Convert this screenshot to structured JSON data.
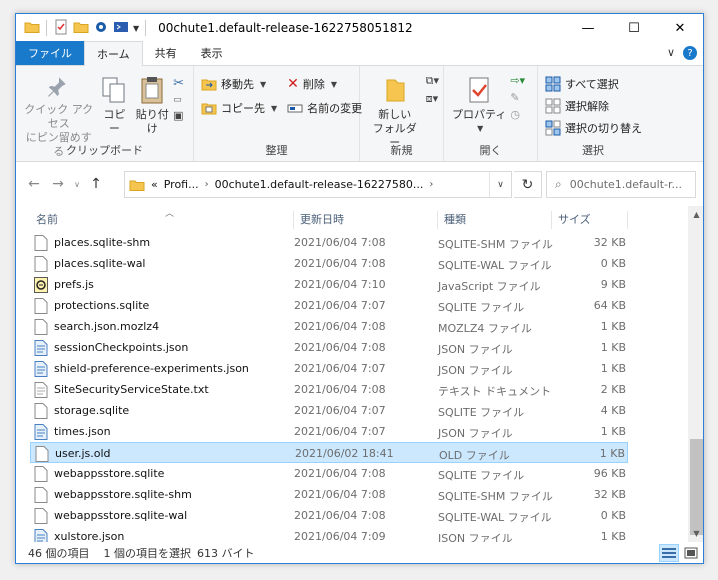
{
  "window": {
    "title": "00chute1.default-release-1622758051812",
    "controls": {
      "minimize": "—",
      "maximize": "☐",
      "close": "✕"
    }
  },
  "ribbon_tabs": {
    "file": "ファイル",
    "home": "ホーム",
    "share": "共有",
    "view": "表示"
  },
  "ribbon": {
    "clipboard": {
      "label": "クリップボード",
      "pin_line1": "クイック アクセス",
      "pin_line2": "にピン留めする",
      "copy": "コピー",
      "paste": "貼り付け"
    },
    "organize": {
      "label": "整理",
      "move_to": "移動先",
      "copy_to": "コピー先",
      "delete": "削除",
      "rename": "名前の変更"
    },
    "new": {
      "label": "新規",
      "new_folder_line1": "新しい",
      "new_folder_line2": "フォルダー"
    },
    "open": {
      "label": "開く",
      "properties": "プロパティ"
    },
    "select": {
      "label": "選択",
      "select_all": "すべて選択",
      "select_none": "選択解除",
      "invert": "選択の切り替え"
    }
  },
  "address": {
    "prefix": "«",
    "crumb1": "Profi...",
    "crumb2": "00chute1.default-release-16227580..."
  },
  "search": {
    "placeholder": "00chute1.default-r..."
  },
  "columns": {
    "name": "名前",
    "date": "更新日時",
    "type": "種類",
    "size": "サイズ"
  },
  "files": [
    {
      "name": "places.sqlite-shm",
      "date": "2021/06/04 7:08",
      "type": "SQLITE-SHM ファイル",
      "size": "32 KB",
      "icon": "file-icon"
    },
    {
      "name": "places.sqlite-wal",
      "date": "2021/06/04 7:08",
      "type": "SQLITE-WAL ファイル",
      "size": "0 KB",
      "icon": "file-icon"
    },
    {
      "name": "prefs.js",
      "date": "2021/06/04 7:10",
      "type": "JavaScript ファイル",
      "size": "9 KB",
      "icon": "script-icon"
    },
    {
      "name": "protections.sqlite",
      "date": "2021/06/04 7:07",
      "type": "SQLITE ファイル",
      "size": "64 KB",
      "icon": "file-icon"
    },
    {
      "name": "search.json.mozlz4",
      "date": "2021/06/04 7:08",
      "type": "MOZLZ4 ファイル",
      "size": "1 KB",
      "icon": "file-icon"
    },
    {
      "name": "sessionCheckpoints.json",
      "date": "2021/06/04 7:08",
      "type": "JSON ファイル",
      "size": "1 KB",
      "icon": "json-icon"
    },
    {
      "name": "shield-preference-experiments.json",
      "date": "2021/06/04 7:07",
      "type": "JSON ファイル",
      "size": "1 KB",
      "icon": "json-icon"
    },
    {
      "name": "SiteSecurityServiceState.txt",
      "date": "2021/06/04 7:08",
      "type": "テキスト ドキュメント",
      "size": "2 KB",
      "icon": "text-icon"
    },
    {
      "name": "storage.sqlite",
      "date": "2021/06/04 7:07",
      "type": "SQLITE ファイル",
      "size": "4 KB",
      "icon": "file-icon"
    },
    {
      "name": "times.json",
      "date": "2021/06/04 7:07",
      "type": "JSON ファイル",
      "size": "1 KB",
      "icon": "json-icon"
    },
    {
      "name": "user.js.old",
      "date": "2021/06/02 18:41",
      "type": "OLD ファイル",
      "size": "1 KB",
      "icon": "file-icon",
      "selected": true
    },
    {
      "name": "webappsstore.sqlite",
      "date": "2021/06/04 7:08",
      "type": "SQLITE ファイル",
      "size": "96 KB",
      "icon": "file-icon"
    },
    {
      "name": "webappsstore.sqlite-shm",
      "date": "2021/06/04 7:08",
      "type": "SQLITE-SHM ファイル",
      "size": "32 KB",
      "icon": "file-icon"
    },
    {
      "name": "webappsstore.sqlite-wal",
      "date": "2021/06/04 7:08",
      "type": "SQLITE-WAL ファイル",
      "size": "0 KB",
      "icon": "file-icon"
    },
    {
      "name": "xulstore.json",
      "date": "2021/06/04 7:09",
      "type": "JSON ファイル",
      "size": "1 KB",
      "icon": "json-icon"
    }
  ],
  "status": {
    "count": "46 個の項目",
    "selected": "1 個の項目を選択",
    "size": "613 バイト"
  },
  "colors": {
    "accent": "#1979ca",
    "selection": "#cce8ff",
    "selection_border": "#99d1ff"
  }
}
